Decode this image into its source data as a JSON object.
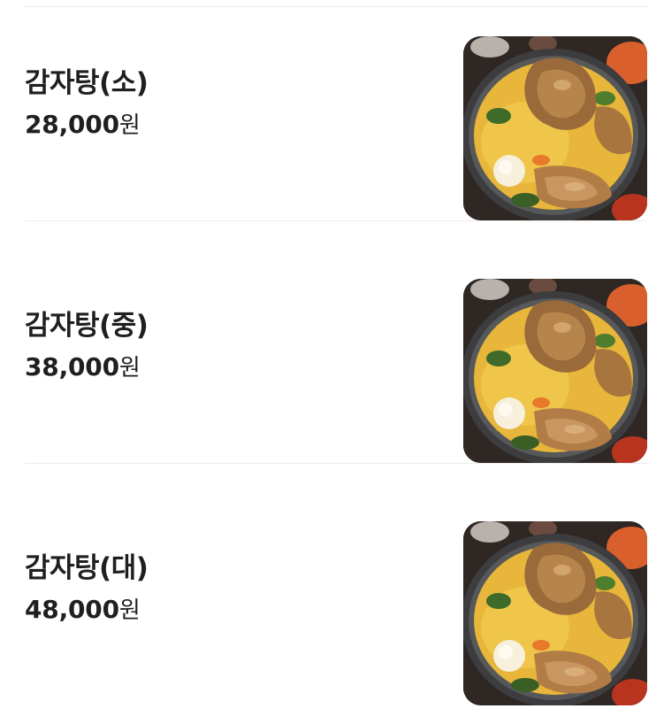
{
  "menu": {
    "items": [
      {
        "name": "감자탕(소)",
        "price": "28,000",
        "currency": "원",
        "image": "gamjatang-photo"
      },
      {
        "name": "감자탕(중)",
        "price": "38,000",
        "currency": "원",
        "image": "gamjatang-photo"
      },
      {
        "name": "감자탕(대)",
        "price": "48,000",
        "currency": "원",
        "image": "gamjatang-photo"
      }
    ]
  },
  "colors": {
    "text": "#1f1f1f",
    "divider": "#ececec",
    "background": "#ffffff"
  }
}
